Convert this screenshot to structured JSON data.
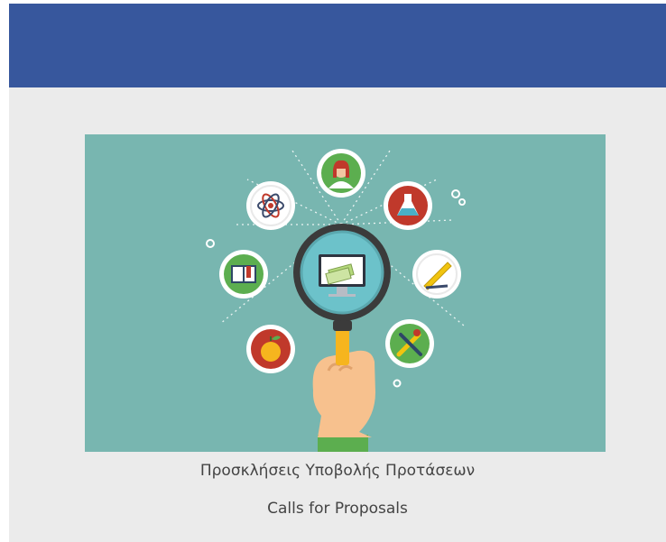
{
  "header": {
    "background_color": "#37579d"
  },
  "banner": {
    "background_color": "#78b6b0",
    "icons": [
      "atom-icon",
      "scientist-icon",
      "flask-icon",
      "gear-icon",
      "gear-icon",
      "book-icon",
      "ruler-pencil-icon",
      "apple-icon",
      "paint-palette-icon",
      "magnifier-icon",
      "monitor-icon",
      "money-icon",
      "hand-icon"
    ]
  },
  "captions": {
    "greek": "Προσκλήσεις Υποβολής Προτάσεων",
    "english": "Calls for Proposals"
  }
}
